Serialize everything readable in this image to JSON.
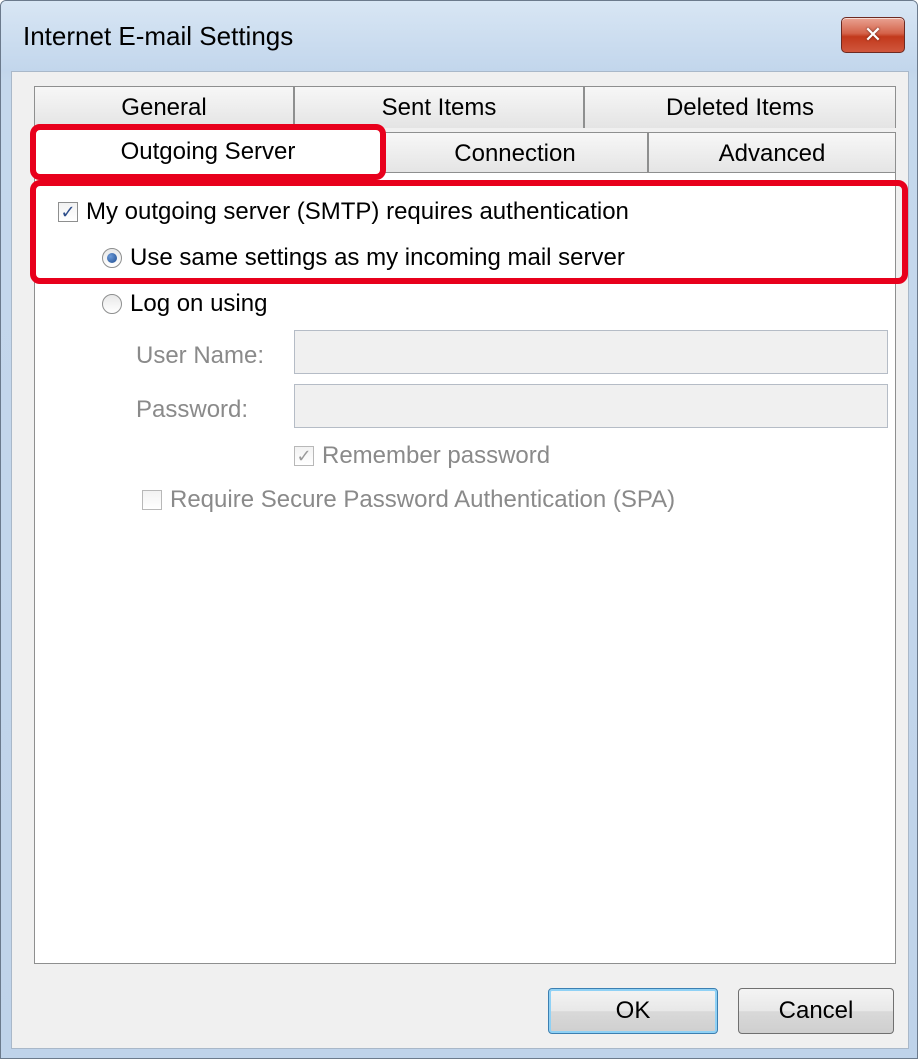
{
  "window": {
    "title": "Internet E-mail Settings",
    "close_label": "✕"
  },
  "tabs": {
    "row1": [
      "General",
      "Sent Items",
      "Deleted Items"
    ],
    "row2": [
      "Outgoing Server",
      "Connection",
      "Advanced"
    ],
    "active": "Outgoing Server"
  },
  "outgoing": {
    "smtp_auth_label": "My outgoing server (SMTP) requires authentication",
    "smtp_auth_checked": true,
    "same_settings_label": "Use same settings as my incoming mail server",
    "same_settings_selected": true,
    "log_on_label": "Log on using",
    "log_on_selected": false,
    "user_name_label": "User Name:",
    "user_name_value": "",
    "password_label": "Password:",
    "password_value": "",
    "remember_password_label": "Remember password",
    "remember_password_checked": true,
    "spa_label": "Require Secure Password Authentication (SPA)",
    "spa_checked": false
  },
  "buttons": {
    "ok": "OK",
    "cancel": "Cancel"
  },
  "colors": {
    "highlight": "#e8001c",
    "accent": "#3c7fb1"
  }
}
